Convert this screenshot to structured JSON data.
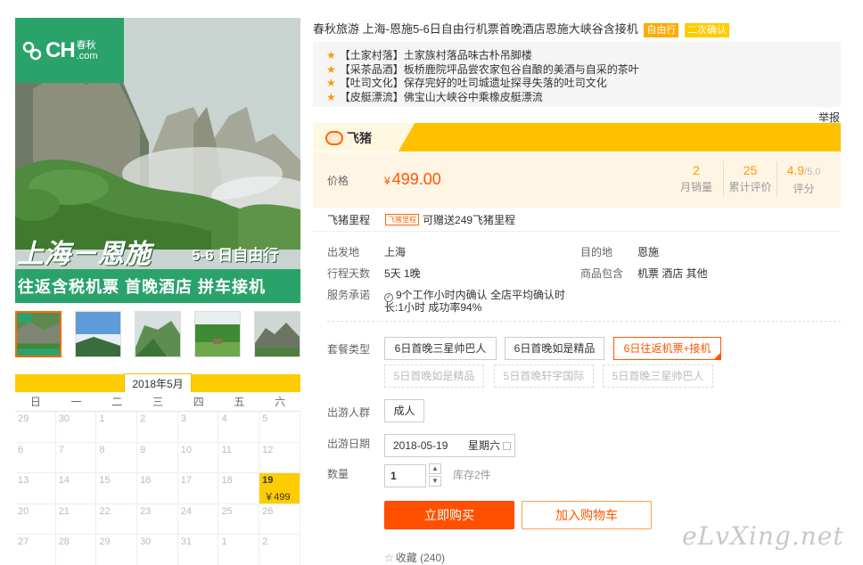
{
  "gallery": {
    "logo_main": "CH",
    "logo_top": "春秋",
    "logo_bottom": ".com",
    "banner_big": "上海－恩施",
    "banner_small": "5-6 日自由行",
    "banner_bar": "往返含税机票  首晚酒店  拼车接机",
    "thumb_count": 5,
    "active_thumb": 0
  },
  "calendar": {
    "month": "2018年5月",
    "weekdays": [
      "日",
      "一",
      "二",
      "三",
      "四",
      "五",
      "六"
    ],
    "days": [
      "29",
      "30",
      "1",
      "2",
      "3",
      "4",
      "5",
      "6",
      "7",
      "8",
      "9",
      "10",
      "11",
      "12",
      "13",
      "14",
      "15",
      "16",
      "17",
      "18",
      "19",
      "20",
      "21",
      "22",
      "23",
      "24",
      "25",
      "26",
      "27",
      "28",
      "29",
      "30",
      "31",
      "1",
      "2"
    ],
    "available_day": "19",
    "available_price": "￥499"
  },
  "product": {
    "title": "春秋旅游 上海-恩施5-6日自由行机票首晚酒店恩施大峡谷含接机",
    "tag1": "自由行",
    "tag2": "二次确认",
    "highlights": [
      "【土家村落】土家族村落品味古朴吊脚楼",
      "【采茶品酒】板桥鹿院坪品尝农家包谷自酿的美酒与自采的茶叶",
      "【吐司文化】保存完好的吐司城遗址探寻失落的吐司文化",
      "【皮艇漂流】佛宝山大峡谷中乘橡皮艇漂流"
    ],
    "report": "举报",
    "platform": "飞猪"
  },
  "price": {
    "label": "价格",
    "currency": "¥",
    "value": "499.00",
    "monthly_sales": "2",
    "monthly_sales_label": "月销量",
    "reviews": "25",
    "reviews_label": "累计评价",
    "rating": "4.9",
    "rating_of": "/5.0",
    "rating_label": "评分"
  },
  "miles": {
    "label": "飞猪里程",
    "tag": "飞猪里程",
    "text": "可赠送249飞猪里程"
  },
  "info": {
    "from_label": "出发地",
    "from": "上海",
    "to_label": "目的地",
    "to": "恩施",
    "days_label": "行程天数",
    "days": "5天  1晚",
    "includes_label": "商品包含",
    "includes": "机票  酒店  其他",
    "service_label": "服务承诺",
    "service_line1": "9个工作小时内确认  全店平均确认时",
    "service_line2": "长:1小时  成功率94%"
  },
  "package": {
    "label": "套餐类型",
    "options": [
      {
        "label": "6日首晚三星帅巴人",
        "state": "normal"
      },
      {
        "label": "6日首晚如是精品",
        "state": "normal"
      },
      {
        "label": "6日往返机票+接机",
        "state": "selected"
      },
      {
        "label": "5日首晚如是精品",
        "state": "disabled"
      },
      {
        "label": "5日首晚轩宇国际",
        "state": "disabled"
      },
      {
        "label": "5日首晚三星帅巴人",
        "state": "disabled"
      }
    ]
  },
  "travelers": {
    "label": "出游人群",
    "value": "成人"
  },
  "date": {
    "label": "出游日期",
    "value": "2018-05-19",
    "weekday": "星期六"
  },
  "quantity": {
    "label": "数量",
    "value": "1",
    "stock": "库存2件"
  },
  "actions": {
    "buy": "立即购买",
    "cart": "加入购物车"
  },
  "favorite": {
    "label": "收藏",
    "count": "(240)"
  },
  "watermark": "eLvXing.net",
  "colors": {
    "accent": "#ff5000",
    "brand_green": "#2aa36b",
    "fliggy_yellow": "#ffc000"
  }
}
